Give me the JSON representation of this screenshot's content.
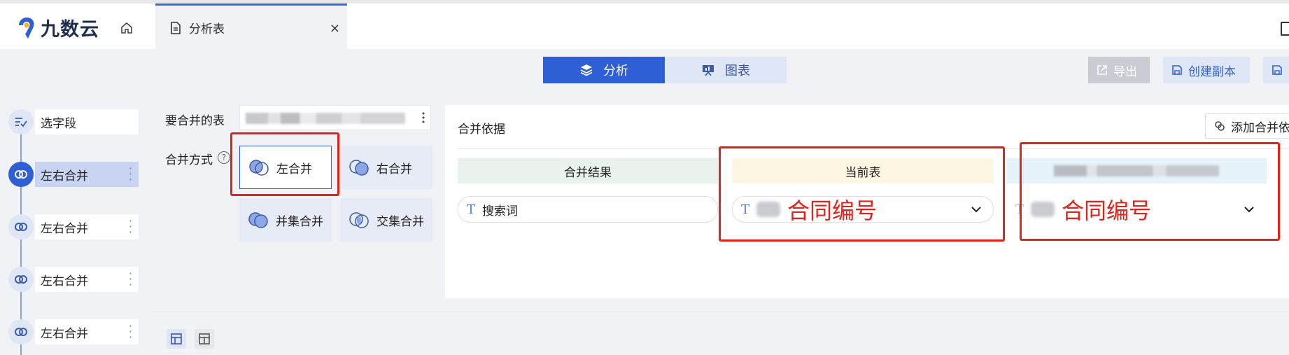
{
  "app": {
    "logo_text": "九数云"
  },
  "tab": {
    "label": "分析表",
    "close_glyph": "×"
  },
  "toolbar": {
    "analysis_label": "分析",
    "chart_label": "图表",
    "export_label": "导出",
    "copy_label": "创建副本"
  },
  "sidebar": {
    "items": [
      {
        "label": "选字段",
        "icon": "field-select-icon"
      },
      {
        "label": "左右合并",
        "icon": "merge-icon",
        "active": true
      },
      {
        "label": "左右合并",
        "icon": "merge-icon"
      },
      {
        "label": "左右合并",
        "icon": "merge-icon"
      },
      {
        "label": "左右合并",
        "icon": "merge-icon"
      }
    ]
  },
  "config": {
    "target_table_label": "要合并的表",
    "merge_mode_label": "合并方式",
    "help_glyph": "?",
    "options": {
      "left": "左合并",
      "right": "右合并",
      "union": "并集合并",
      "intersect": "交集合并"
    }
  },
  "criteria": {
    "title": "合并依据",
    "add_button": "添加合并依",
    "columns": {
      "result": "合并结果",
      "current": "当前表"
    },
    "rows": [
      {
        "result_field": "搜索词",
        "current_annotation": "合同编号",
        "other_annotation": "合同编号"
      }
    ]
  },
  "colors": {
    "accent": "#2f5fd6",
    "highlight_red": "#e0241b",
    "result_bg": "#e9f3ec",
    "current_bg": "#fdf6e3",
    "other_bg": "#e6f3fb"
  }
}
